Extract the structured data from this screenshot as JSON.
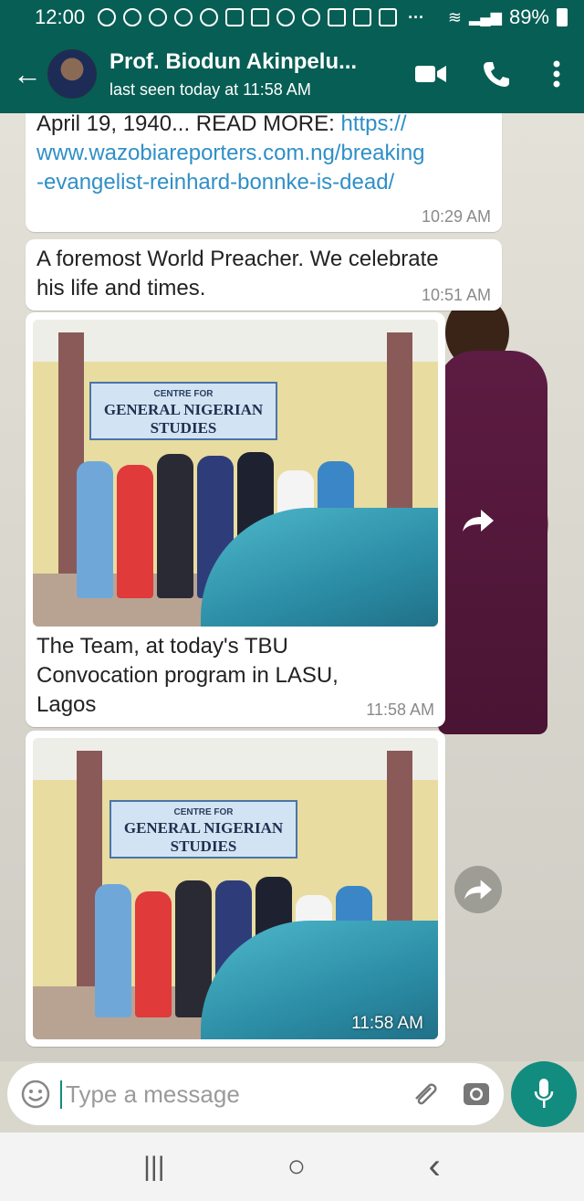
{
  "statusbar": {
    "time": "12:00",
    "battery": "89%",
    "notif_icons": [
      "sync-icon",
      "sync-icon",
      "line-icon",
      "chat-icon",
      "whatsapp-icon",
      "voicemail-icon",
      "calendar-icon",
      "settings-icon",
      "facebook-icon",
      "mail-icon",
      "mail-icon",
      "mail-icon"
    ],
    "more": "···"
  },
  "header": {
    "contact_name": "Prof. Biodun Akinpelu...",
    "last_seen": "last seen today at 11:58 AM",
    "back_icon": "←"
  },
  "messages": [
    {
      "type": "text",
      "text_plain": "April 19, 1940... READ MORE: ",
      "link": "https://www.wazobiareporters.com.ng/breaking-evangelist-reinhard-bonnke-is-dead/",
      "link_line1": "https://",
      "link_line2": "www.wazobiareporters.com.ng/breaking",
      "link_line3": "-evangelist-reinhard-bonnke-is-dead/",
      "time": "10:29 AM"
    },
    {
      "type": "text",
      "text": "A foremost World Preacher. We celebrate his life and times.",
      "line1": "A foremost World Preacher. We celebrate",
      "line2": "his life and times.",
      "time": "10:51 AM"
    },
    {
      "type": "image",
      "sign_top": "CENTRE FOR",
      "sign_main": "GENERAL NIGERIAN STUDIES",
      "caption": "The Team, at today's TBU Convocation program in LASU, Lagos",
      "caption_line1": "The Team, at today's TBU",
      "caption_line2": "Convocation program in LASU,",
      "caption_line3": "Lagos",
      "time": "11:58 AM"
    },
    {
      "type": "image",
      "sign_top": "CENTRE FOR",
      "sign_main": "GENERAL NIGERIAN STUDIES",
      "time": "11:58 AM"
    }
  ],
  "input": {
    "placeholder": "Type a message"
  },
  "navbar": {
    "recent": "|||",
    "home": "○",
    "back": "‹"
  },
  "colors": {
    "header": "#075e54",
    "accent": "#128c7e",
    "link": "#2f8fc7",
    "bubble": "#ffffff"
  }
}
